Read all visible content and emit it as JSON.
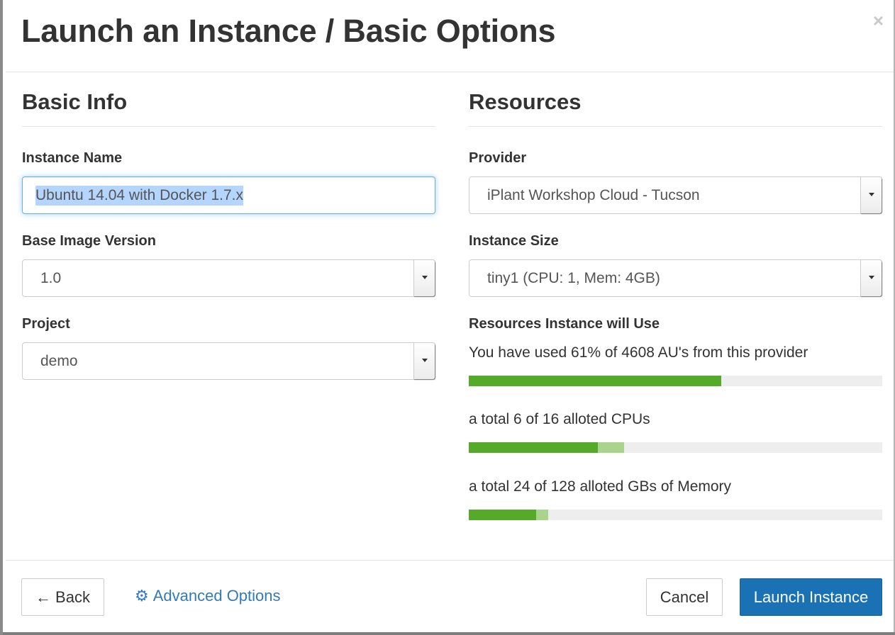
{
  "header": {
    "title": "Launch an Instance / Basic Options",
    "close_icon": "×"
  },
  "basic_info": {
    "section_title": "Basic Info",
    "instance_name_label": "Instance Name",
    "instance_name_value": "Ubuntu 14.04 with Docker 1.7.x",
    "base_image_label": "Base Image Version",
    "base_image_value": "1.0",
    "project_label": "Project",
    "project_value": "demo"
  },
  "resources": {
    "section_title": "Resources",
    "provider_label": "Provider",
    "provider_value": "iPlant Workshop Cloud - Tucson",
    "instance_size_label": "Instance Size",
    "instance_size_value": "tiny1 (CPU: 1, Mem: 4GB)",
    "usage_title": "Resources Instance will Use",
    "au_text": "You have used 61% of 4608 AU's from this provider",
    "au_used_fraction": 0.61,
    "cpu_text": "a total 6 of 16 alloted CPUs",
    "cpu_used_fraction": 0.3125,
    "cpu_new_fraction": 0.0625,
    "mem_text": "a total 24 of 128 alloted GBs of Memory",
    "mem_used_fraction": 0.1625,
    "mem_new_fraction": 0.03,
    "colors": {
      "used": "#55aa2a",
      "requested": "#a8d48c",
      "track": "#eeeeee"
    }
  },
  "footer": {
    "back_icon": "←",
    "back_label": "Back",
    "advanced_icon": "⚙",
    "advanced_label": "Advanced Options",
    "cancel_label": "Cancel",
    "launch_label": "Launch Instance",
    "accent_color": "#1a72b5"
  }
}
